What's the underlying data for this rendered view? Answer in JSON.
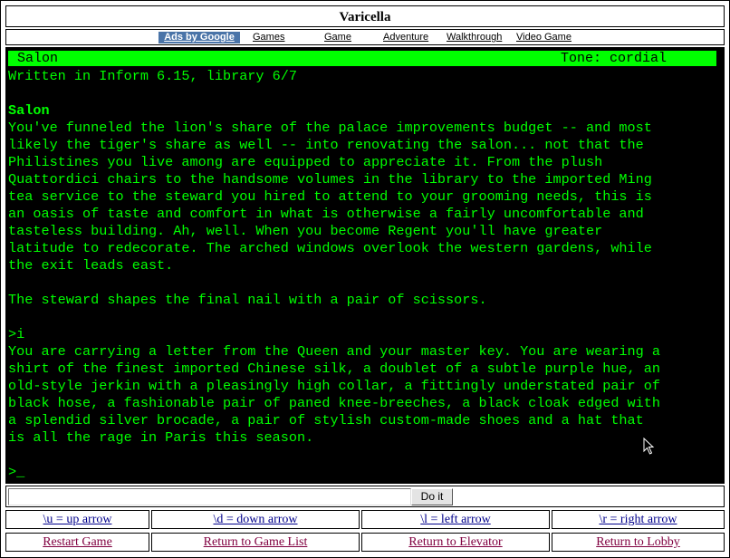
{
  "window": {
    "title": "Varicella"
  },
  "nav": {
    "ads_label": "Ads by Google",
    "links": [
      "Games",
      "Game",
      "Adventure",
      "Walkthrough",
      "Video Game"
    ]
  },
  "status": {
    "room": "Salon",
    "tone": "Tone: cordial"
  },
  "transcript": [
    {
      "text": "Written in Inform 6.15, library 6/7",
      "bold": false
    },
    {
      "text": "",
      "bold": false
    },
    {
      "text": "Salon",
      "bold": true
    },
    {
      "text": "You've funneled the lion's share of the palace improvements budget -- and most",
      "bold": false
    },
    {
      "text": "likely the tiger's share as well -- into renovating the salon... not that the",
      "bold": false
    },
    {
      "text": "Philistines you live among are equipped to appreciate it. From the plush",
      "bold": false
    },
    {
      "text": "Quattordici chairs to the handsome volumes in the library to the imported Ming",
      "bold": false
    },
    {
      "text": "tea service to the steward you hired to attend to your grooming needs, this is",
      "bold": false
    },
    {
      "text": "an oasis of taste and comfort in what is otherwise a fairly uncomfortable and",
      "bold": false
    },
    {
      "text": "tasteless building. Ah, well. When you become Regent you'll have greater",
      "bold": false
    },
    {
      "text": "latitude to redecorate. The arched windows overlook the western gardens, while",
      "bold": false
    },
    {
      "text": "the exit leads east.",
      "bold": false
    },
    {
      "text": "",
      "bold": false
    },
    {
      "text": "The steward shapes the final nail with a pair of scissors.",
      "bold": false
    },
    {
      "text": "",
      "bold": false
    },
    {
      "text": ">i",
      "bold": false
    },
    {
      "text": "You are carrying a letter from the Queen and your master key. You are wearing a",
      "bold": false
    },
    {
      "text": "shirt of the finest imported Chinese silk, a doublet of a subtle purple hue, an",
      "bold": false
    },
    {
      "text": "old-style jerkin with a pleasingly high collar, a fittingly understated pair of",
      "bold": false
    },
    {
      "text": "black hose, a fashionable pair of paned knee-breeches, a black cloak edged with",
      "bold": false
    },
    {
      "text": "a splendid silver brocade, a pair of stylish custom-made shoes and a hat that",
      "bold": false
    },
    {
      "text": "is all the rage in Paris this season.",
      "bold": false
    },
    {
      "text": "",
      "bold": false
    },
    {
      "text": ">_",
      "bold": false
    }
  ],
  "command": {
    "value": "",
    "button_label": "Do it"
  },
  "shortcuts": [
    "\\u = up arrow",
    "\\d = down arrow",
    "\\l = left arrow",
    "\\r = right arrow"
  ],
  "footer_links": [
    "Restart Game",
    "Return to Game List",
    "Return to Elevator",
    "Return to Lobby"
  ],
  "colors": {
    "terminal_bg": "#000000",
    "terminal_text": "#00ff00",
    "status_bg": "#00ff00",
    "ads_bg": "#4a74a8"
  }
}
